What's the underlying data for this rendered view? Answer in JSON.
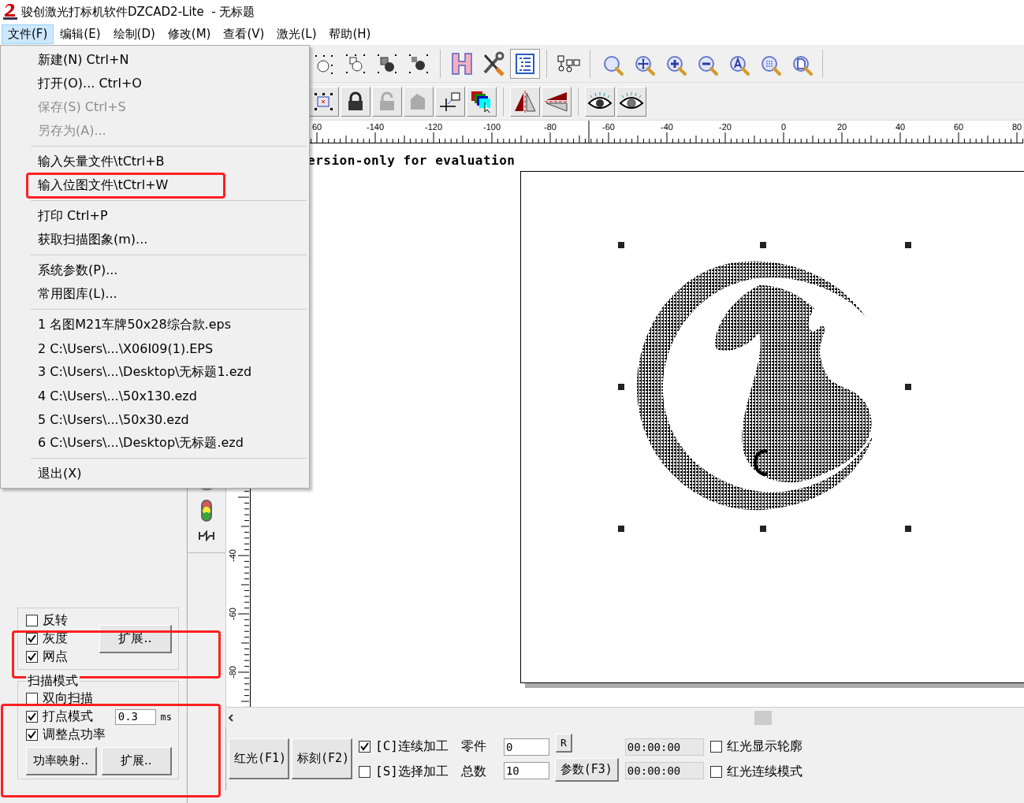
{
  "window": {
    "title": "骏创激光打标机软件DZCAD2-Lite  - 无标题"
  },
  "menu_bar": [
    {
      "label": "文件(F)",
      "selected": true
    },
    {
      "label": "编辑(E)",
      "selected": false
    },
    {
      "label": "绘制(D)",
      "selected": false
    },
    {
      "label": "修改(M)",
      "selected": false
    },
    {
      "label": "查看(V)",
      "selected": false
    },
    {
      "label": "激光(L)",
      "selected": false
    },
    {
      "label": "帮助(H)",
      "selected": false
    }
  ],
  "file_menu": {
    "sections": [
      [
        {
          "label": "新建(N) Ctrl+N",
          "disabled": false,
          "highlighted": false
        },
        {
          "label": "打开(O)... Ctrl+O",
          "disabled": false,
          "highlighted": false
        },
        {
          "label": "保存(S) Ctrl+S",
          "disabled": true,
          "highlighted": false
        },
        {
          "label": "另存为(A)...",
          "disabled": true,
          "highlighted": false
        }
      ],
      [
        {
          "label": "输入矢量文件\\tCtrl+B",
          "disabled": false,
          "highlighted": false
        },
        {
          "label": "输入位图文件\\tCtrl+W",
          "disabled": false,
          "highlighted": true
        }
      ],
      [
        {
          "label": "打印 Ctrl+P",
          "disabled": false,
          "highlighted": false
        },
        {
          "label": "获取扫描图象(m)...",
          "disabled": false,
          "highlighted": false
        }
      ],
      [
        {
          "label": "系统参数(P)...",
          "disabled": false,
          "highlighted": false
        },
        {
          "label": "常用图库(L)...",
          "disabled": false,
          "highlighted": false
        }
      ],
      [
        {
          "label": "1 名图M21车牌50x28综合款.eps",
          "disabled": false,
          "highlighted": false
        },
        {
          "label": "2 C:\\Users\\...\\X06I09(1).EPS",
          "disabled": false,
          "highlighted": false
        },
        {
          "label": "3 C:\\Users\\...\\Desktop\\无标题1.ezd",
          "disabled": false,
          "highlighted": false
        },
        {
          "label": "4 C:\\Users\\...\\50x130.ezd",
          "disabled": false,
          "highlighted": false
        },
        {
          "label": "5 C:\\Users\\...\\50x30.ezd",
          "disabled": false,
          "highlighted": false
        },
        {
          "label": "6 C:\\Users\\...\\Desktop\\无标题.ezd",
          "disabled": false,
          "highlighted": false
        }
      ],
      [
        {
          "label": "退出(X)",
          "disabled": false,
          "highlighted": false
        }
      ]
    ]
  },
  "ruler": {
    "top_labels": [
      "60",
      "-140",
      "-120",
      "-100",
      "-80",
      "-60",
      "-40",
      "-20",
      "0",
      "20",
      "40",
      "60",
      "80"
    ],
    "side_labels": [
      "-40",
      "-60",
      "-80"
    ]
  },
  "canvas": {
    "notice": "ersion-only for evaluation"
  },
  "image_panel": {
    "checks": [
      {
        "label": "反转",
        "checked": false
      },
      {
        "label": "灰度",
        "checked": true
      },
      {
        "label": "网点",
        "checked": true
      }
    ],
    "extend_button": "扩展..",
    "highlighted": true,
    "scan_mode": {
      "title": "扫描模式",
      "highlighted": true,
      "checks": [
        {
          "label": "双向扫描",
          "checked": false
        },
        {
          "label": "打点模式",
          "checked": true,
          "value": "0.3",
          "unit": "ms"
        },
        {
          "label": "调整点功率",
          "checked": true
        }
      ],
      "buttons": [
        "功率映射..",
        "扩展.."
      ]
    }
  },
  "bottom_bar": {
    "red_light_button": "红光(F1)",
    "mark_button": "标刻(F2)",
    "modes": [
      {
        "label": "[C]连续加工",
        "checked": true
      },
      {
        "label": "[S]选择加工",
        "checked": false
      }
    ],
    "part_label": "零件",
    "part_value": "0",
    "reset_button": "R",
    "total_label": "总数",
    "total_value": "10",
    "params_button": "参数(F3)",
    "times": [
      "00:00:00",
      "00:00:00"
    ],
    "options": [
      {
        "label": "红光显示轮廓",
        "checked": false
      },
      {
        "label": "红光连续模式",
        "checked": false
      }
    ]
  }
}
